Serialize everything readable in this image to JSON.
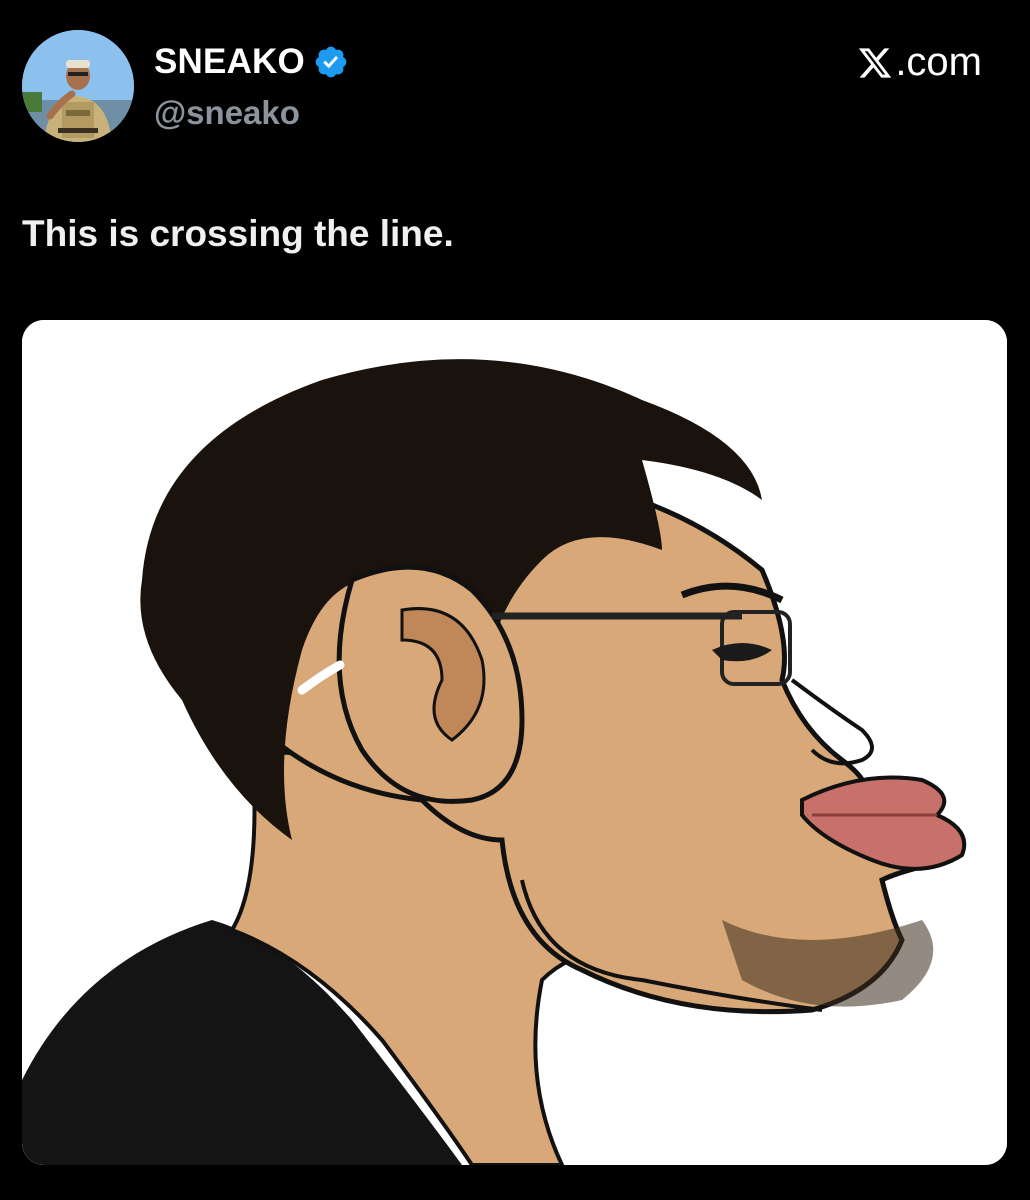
{
  "author": {
    "display_name": "SNEAKO",
    "handle": "@sneako",
    "verified": true,
    "avatar_icon": "profile-photo-icon",
    "badge_color": "#1d9bf0"
  },
  "brand": {
    "label": ".com",
    "logo_icon": "x-logo-icon"
  },
  "post": {
    "text": "This is crossing the line."
  },
  "media": {
    "type": "image",
    "icon": "cartoon-illustration-icon"
  },
  "colors": {
    "background": "#000000",
    "text": "#ffffff",
    "handle": "#8b939c"
  }
}
